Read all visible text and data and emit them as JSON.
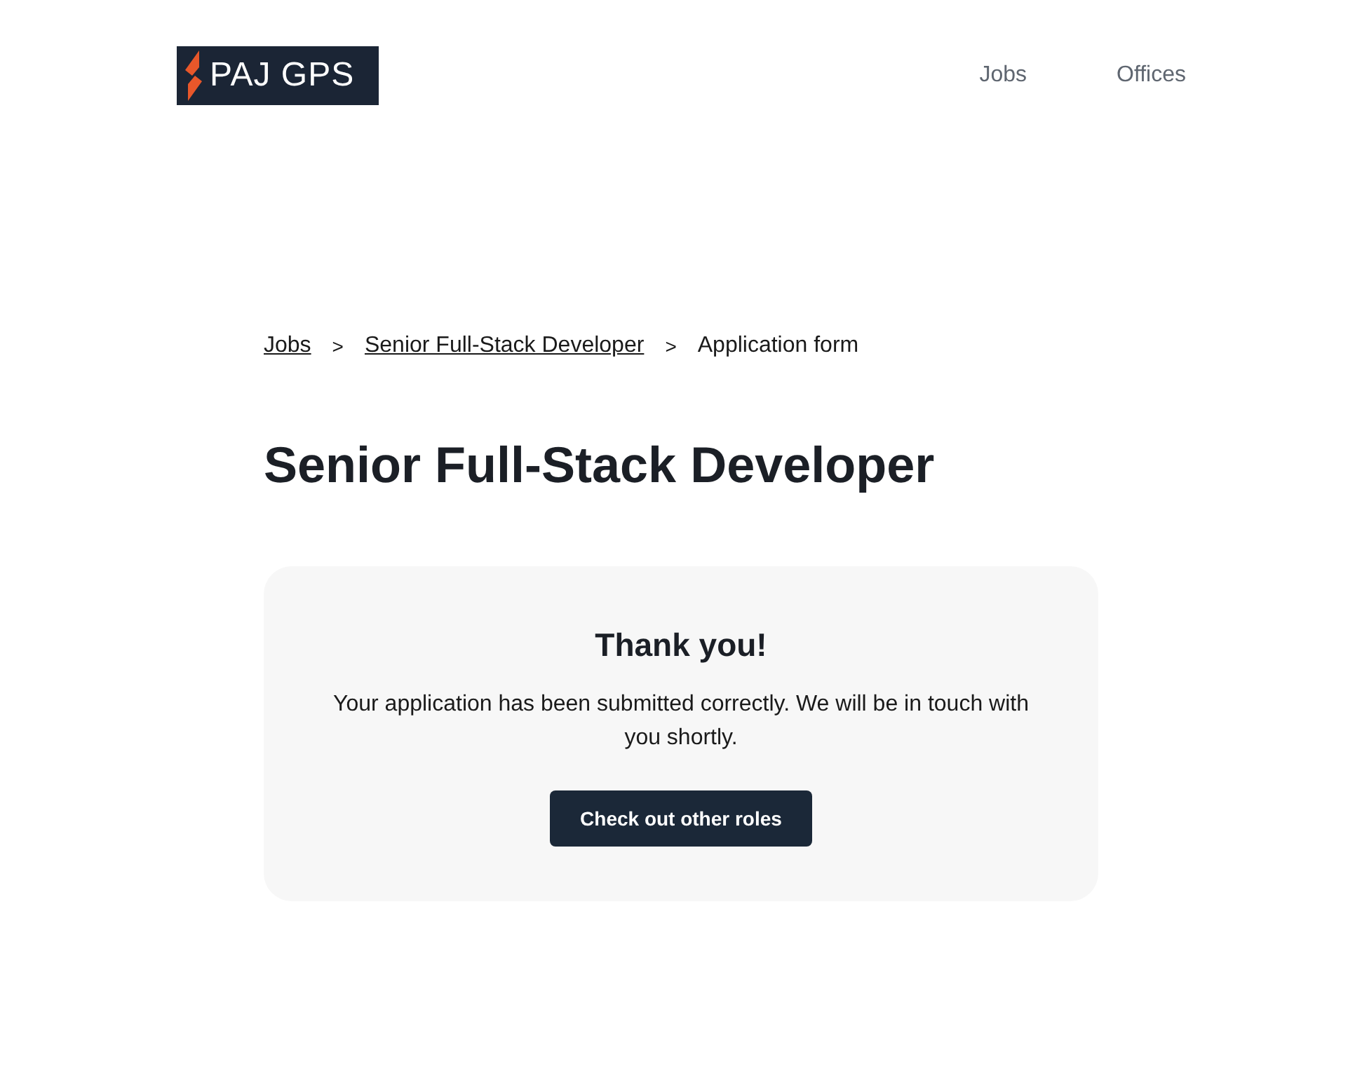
{
  "header": {
    "logo": {
      "text": "PAJ GPS"
    },
    "nav": [
      {
        "label": "Jobs"
      },
      {
        "label": "Offices"
      }
    ]
  },
  "breadcrumb": [
    {
      "label": "Jobs",
      "kind": "link"
    },
    {
      "label": ">",
      "kind": "separator"
    },
    {
      "label": "Senior Full-Stack Developer",
      "kind": "link"
    },
    {
      "label": ">",
      "kind": "separator"
    },
    {
      "label": "Application form",
      "kind": "current"
    }
  ],
  "title": "Senior Full-Stack Developer",
  "confirmation": {
    "heading": "Thank you!",
    "message": "Your application has been submitted correctly. We will be in touch with you shortly.",
    "button": "Check out other roles"
  }
}
